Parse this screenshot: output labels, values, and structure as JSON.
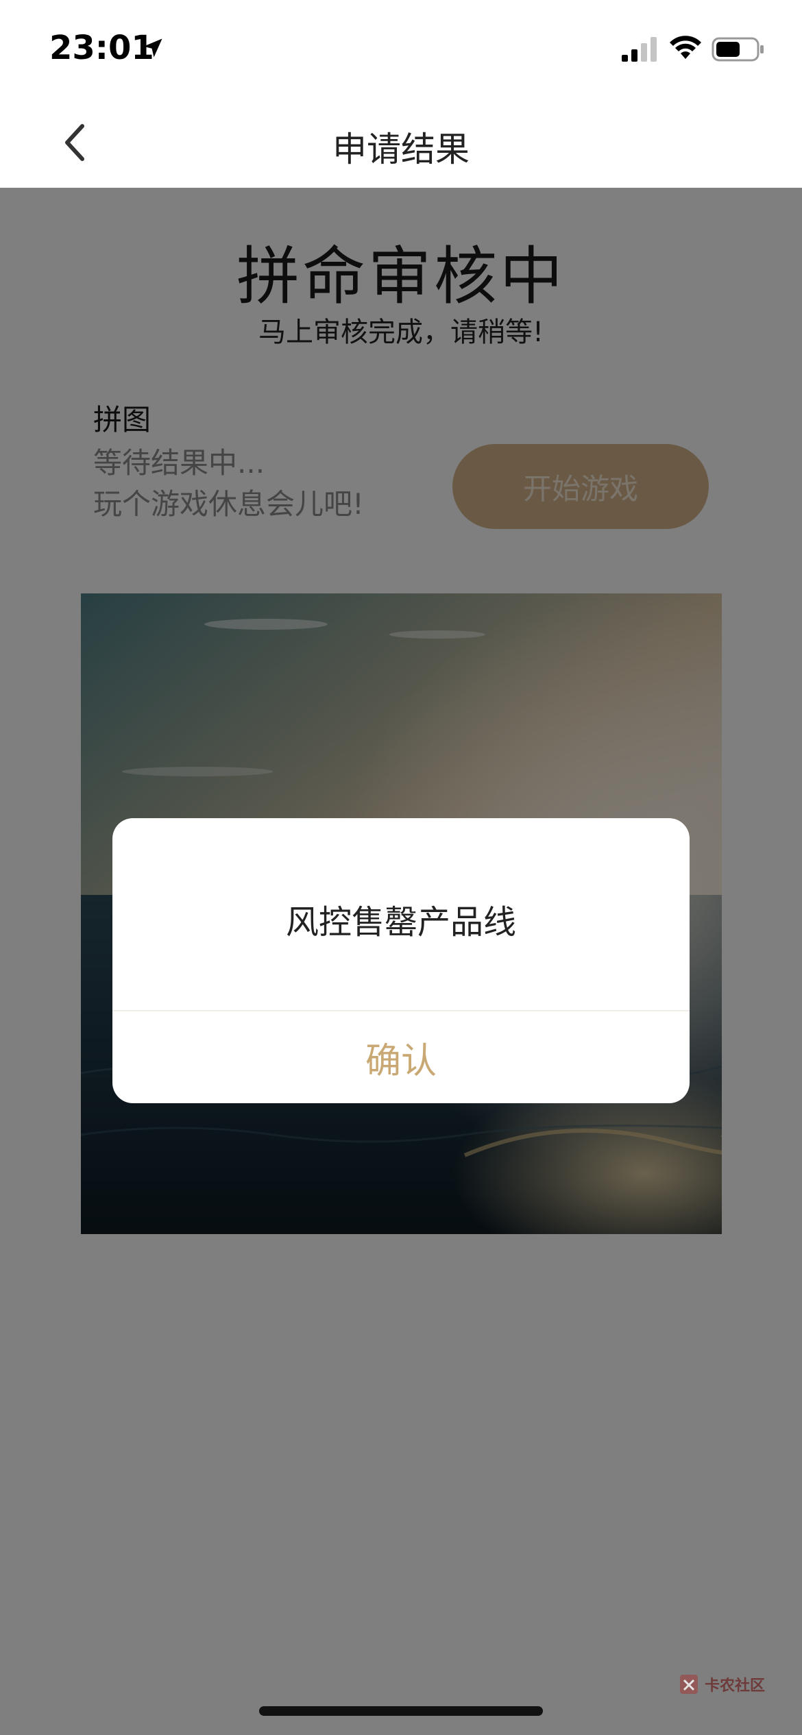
{
  "status_bar": {
    "time": "23:01",
    "icons": [
      "location-arrow-icon",
      "cellular-signal-icon",
      "wifi-icon",
      "battery-icon"
    ]
  },
  "nav": {
    "title": "申请结果",
    "back_icon": "chevron-left-icon"
  },
  "review": {
    "title": "拼命审核中",
    "subtitle": "马上审核完成，请稍等!"
  },
  "game": {
    "label": "拼图",
    "desc_line1": "等待结果中...",
    "desc_line2": "玩个游戏休息会儿吧!",
    "start_button": "开始游戏",
    "accent_color": "#d4b48a"
  },
  "dialog": {
    "message": "风控售罄产品线",
    "confirm_label": "确认",
    "confirm_color": "#c9a874"
  },
  "watermark": {
    "text": "卡农社区"
  }
}
